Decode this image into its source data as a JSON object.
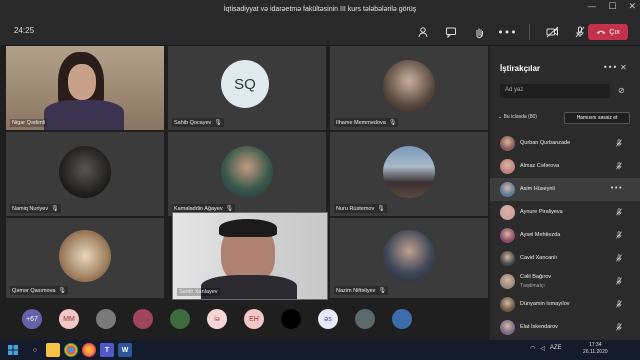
{
  "window": {
    "title": "İqtisadiyyat və idarəetmə fakültəsinin III kurs tələbələrilə görüş",
    "minimize": "—",
    "maximize": "☐",
    "close": "✕"
  },
  "toolbar": {
    "timer": "24:25",
    "icons": [
      "participants-icon",
      "chat-icon",
      "raise-hand-icon",
      "more-icon",
      "camera-icon",
      "mic-off-icon",
      "share-icon"
    ],
    "leave_label": "Çıx",
    "leave_icon": "phone-hangup-icon",
    "leave_color": "#c4314b"
  },
  "tiles": [
    {
      "name": "Nigar Qədimli",
      "type": "video"
    },
    {
      "name": "Sahib Qocayev",
      "type": "initials",
      "initials": "SQ"
    },
    {
      "name": "Ilhame Memmedova",
      "type": "avatar"
    },
    {
      "name": "Namiq Nuriyev",
      "type": "avatar"
    },
    {
      "name": "Kamaladdin Ağayev",
      "type": "avatar"
    },
    {
      "name": "Nuru Rüstemov",
      "type": "avatar"
    },
    {
      "name": "Qəmər Qasımova",
      "type": "avatar"
    },
    {
      "name": "Samir Xanlayev",
      "type": "video"
    },
    {
      "name": "Nazim Niftəliyev",
      "type": "avatar"
    }
  ],
  "strip": [
    {
      "label": "+67",
      "color": "#6264a7"
    },
    {
      "label": "MM",
      "color": "#f4c6c6",
      "text_color": "#8b3a3a"
    },
    {
      "label": "",
      "color": "#7a7a7a"
    },
    {
      "label": "",
      "color": "#a0445c"
    },
    {
      "label": "",
      "color": "#3d6b3d"
    },
    {
      "label": "iə",
      "color": "#f9d6d6",
      "text_color": "#a04040"
    },
    {
      "label": "EH",
      "color": "#f4c6c6",
      "text_color": "#8b3a3a"
    },
    {
      "label": "",
      "color": "#000000"
    },
    {
      "label": "əs",
      "color": "#e6e8fb",
      "text_color": "#4a4fa8"
    },
    {
      "label": "",
      "color": "#5a6a6a"
    },
    {
      "label": "",
      "color": "#3b6ea8"
    }
  ],
  "panel": {
    "title": "İştirakçılar",
    "more": "•••",
    "close": "✕",
    "search_placeholder": "Ad yaz",
    "section_label": "Bu iclasda (80)",
    "mute_all": "Hamısını səssiz et",
    "participants": [
      {
        "name": "Qurban Qurbanzade",
        "role": "",
        "color": "#8a5a5a"
      },
      {
        "name": "Almaz Cəfərova",
        "role": "",
        "color": "#c08080"
      },
      {
        "name": "Asim Hüseynli",
        "role": "",
        "color": "#5a7a9a",
        "highlight": true
      },
      {
        "name": "Aynure Piraliyeva",
        "role": "",
        "color": "#d0a0a0"
      },
      {
        "name": "Aysel Mehtiezda",
        "role": "",
        "color": "#8a4a6a"
      },
      {
        "name": "Cavid Xancanlı",
        "role": "",
        "color": "#4a4a4a"
      },
      {
        "name": "Cəlil Bağırov",
        "role": "Təqdimatçı",
        "color": "#9a8a7a"
      },
      {
        "name": "Dünyamin Ismayılov",
        "role": "",
        "color": "#6a5a4a"
      },
      {
        "name": "Elat İskendarov",
        "role": "",
        "color": "#7a6a8a"
      }
    ]
  },
  "taskbar": {
    "apps": [
      "start-icon",
      "search-icon",
      "taskview-icon",
      "explorer-icon",
      "chrome-icon",
      "firefox-icon",
      "teams-icon",
      "word-icon"
    ],
    "tray": "AZE",
    "time": "17:34",
    "date": "26.11.2020"
  }
}
